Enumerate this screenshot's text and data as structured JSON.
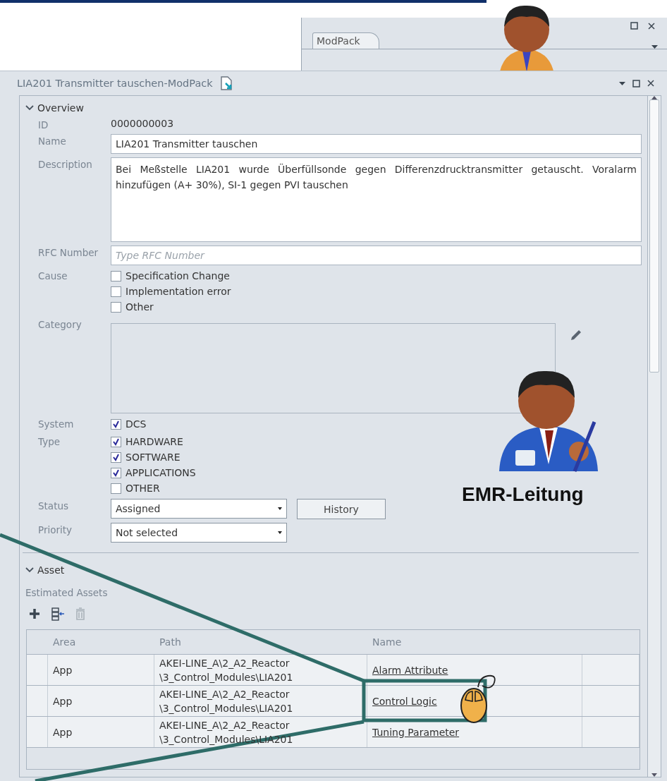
{
  "back_window": {
    "tab": {
      "label": "ModPack",
      "selected": true
    }
  },
  "window": {
    "title": "LIA201 Transmitter tauschen-ModPack",
    "overview": {
      "title": "Overview",
      "expanded": true,
      "id": {
        "label": "ID",
        "value": "0000000003"
      },
      "name": {
        "label": "Name",
        "value": "LIA201 Transmitter tauschen"
      },
      "description": {
        "label": "Description",
        "value": "Bei Meßstelle LIA201 wurde Überfüllsonde gegen Differenzdrucktransmitter getauscht. Voralarm hinzufügen (A+ 30%), SI-1 gegen PVI tauschen"
      },
      "rfc": {
        "label": "RFC Number",
        "placeholder": "Type RFC Number"
      },
      "cause": {
        "label": "Cause",
        "options": [
          {
            "label": "Specification Change",
            "checked": false
          },
          {
            "label": "Implementation error",
            "checked": false
          },
          {
            "label": "Other",
            "checked": false
          }
        ]
      },
      "category": {
        "label": "Category"
      },
      "system": {
        "label": "System",
        "options": [
          {
            "label": "DCS",
            "checked": true
          }
        ]
      },
      "type": {
        "label": "Type",
        "options": [
          {
            "label": "HARDWARE",
            "checked": true
          },
          {
            "label": "SOFTWARE",
            "checked": true
          },
          {
            "label": "APPLICATIONS",
            "checked": true
          },
          {
            "label": "OTHER",
            "checked": false
          }
        ]
      },
      "status": {
        "label": "Status",
        "value": "Assigned",
        "button": "History"
      },
      "priority": {
        "label": "Priority",
        "value": "Not selected"
      }
    },
    "asset": {
      "title": "Asset",
      "expanded": true,
      "subtitle": "Estimated Assets",
      "table": {
        "columns": [
          "Area",
          "Path",
          "Name"
        ],
        "rows": [
          {
            "area": "App",
            "path": [
              "AKEI-LINE_A\\2_A2_Reactor",
              "\\3_Control_Modules\\LIA201"
            ],
            "name": "Alarm Attribute"
          },
          {
            "area": "App",
            "path": [
              "AKEI-LINE_A\\2_A2_Reactor",
              "\\3_Control_Modules\\LIA201"
            ],
            "name": "Control Logic"
          },
          {
            "area": "App",
            "path": [
              "AKEI-LINE_A\\2_A2_Reactor",
              "\\3_Control_Modules\\LIA201"
            ],
            "name": "Tuning Parameter"
          }
        ]
      }
    }
  },
  "annotation": {
    "label": "EMR-Leitung"
  }
}
